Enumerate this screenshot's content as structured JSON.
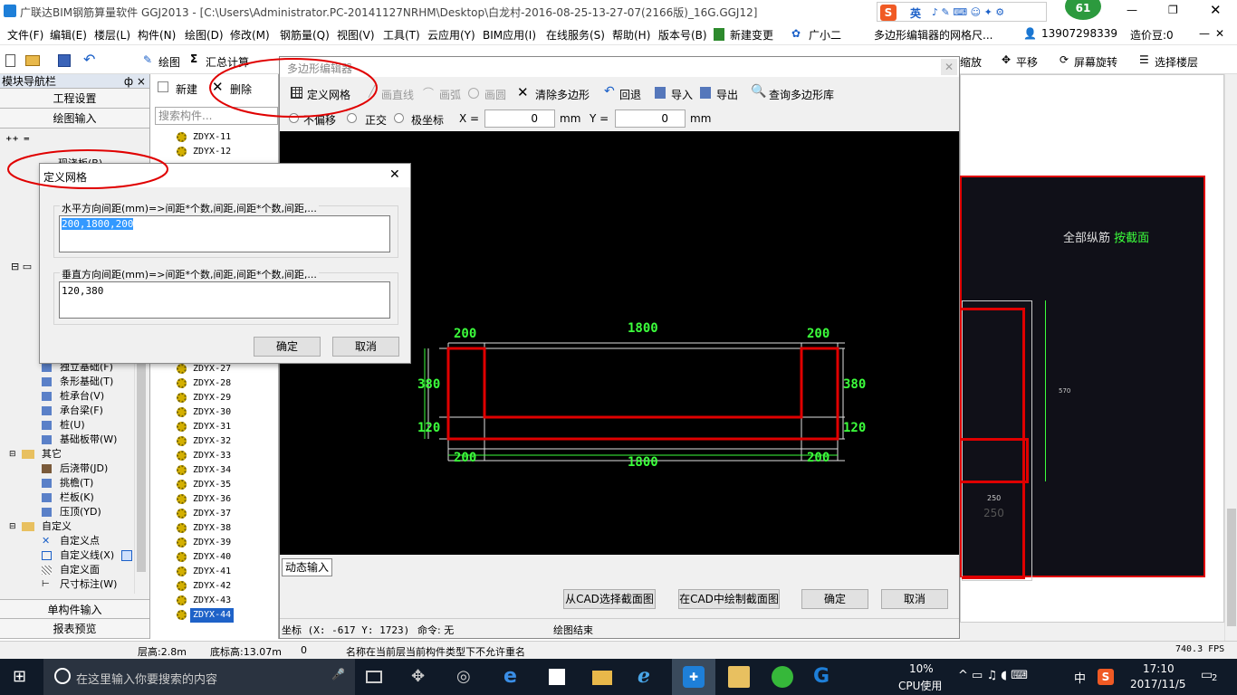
{
  "app": {
    "title": "广联达BIM钢筋算量软件 GGJ2013 - [C:\\Users\\Administrator.PC-20141127NRHM\\Desktop\\白龙村-2016-08-25-13-27-07(2166版)_16G.GGJ12]",
    "badge": "61",
    "ime": "英"
  },
  "menu": [
    "文件(F)",
    "编辑(E)",
    "楼层(L)",
    "构件(N)",
    "绘图(D)",
    "修改(M)",
    "钢筋量(Q)",
    "视图(V)",
    "工具(T)",
    "云应用(Y)",
    "BIM应用(I)",
    "在线服务(S)",
    "帮助(H)",
    "版本号(B)",
    "新建变更",
    "广小二"
  ],
  "menu_right": {
    "hint": "多边形编辑器的网格尺...",
    "phone": "13907298339",
    "price": "造价豆:0"
  },
  "toolbar": {
    "draw": "绘图",
    "calc": "汇总计算",
    "zoom": "缩放",
    "pan": "平移",
    "rotate": "屏幕旋转",
    "floor": "选择楼层"
  },
  "nav": {
    "title": "模块导航栏",
    "pin": "ф ×",
    "project": "工程设置",
    "drawing": "绘图输入",
    "single": "单构件输入",
    "report": "报表预览",
    "slab_cut": "现浇板(B)",
    "tree": [
      {
        "label": "独立基础(F)",
        "indent": 1
      },
      {
        "label": "条形基础(T)",
        "indent": 1
      },
      {
        "label": "桩承台(V)",
        "indent": 1
      },
      {
        "label": "承台梁(F)",
        "indent": 1
      },
      {
        "label": "桩(U)",
        "indent": 1
      },
      {
        "label": "基础板带(W)",
        "indent": 1
      },
      {
        "label": "其它",
        "indent": 0
      },
      {
        "label": "后浇带(JD)",
        "indent": 1
      },
      {
        "label": "挑檐(T)",
        "indent": 1
      },
      {
        "label": "栏板(K)",
        "indent": 1
      },
      {
        "label": "压顶(YD)",
        "indent": 1
      },
      {
        "label": "自定义",
        "indent": 0
      },
      {
        "label": "自定义点",
        "indent": 1
      },
      {
        "label": "自定义线(X)",
        "indent": 1
      },
      {
        "label": "自定义面",
        "indent": 1
      },
      {
        "label": "尺寸标注(W)",
        "indent": 1
      }
    ]
  },
  "components": {
    "new": "新建",
    "delete": "删除",
    "search_placeholder": "搜索构件...",
    "top_items": [
      "ZDYX-11",
      "ZDYX-12"
    ],
    "items": [
      "ZDYX-27",
      "ZDYX-28",
      "ZDYX-29",
      "ZDYX-30",
      "ZDYX-31",
      "ZDYX-32",
      "ZDYX-33",
      "ZDYX-34",
      "ZDYX-35",
      "ZDYX-36",
      "ZDYX-37",
      "ZDYX-38",
      "ZDYX-39",
      "ZDYX-40",
      "ZDYX-41",
      "ZDYX-42",
      "ZDYX-43",
      "ZDYX-44"
    ],
    "selected": "ZDYX-44"
  },
  "poly_editor": {
    "title": "多边形编辑器",
    "tools": {
      "grid": "定义网格",
      "line": "画直线",
      "arc": "画弧",
      "circle": "画圆",
      "clear": "清除多边形",
      "undo": "回退",
      "import": "导入",
      "export": "导出",
      "query": "查询多边形库"
    },
    "offset": {
      "none": "不偏移",
      "ortho": "正交",
      "polar": "极坐标",
      "x_label": "X =",
      "x_value": "0",
      "y_label": "Y =",
      "y_value": "0",
      "unit": "mm"
    },
    "dims_top": [
      "200",
      "1800",
      "200"
    ],
    "dims_bottom": [
      "200",
      "1800",
      "200"
    ],
    "dims_left": [
      "380",
      "120"
    ],
    "dims_right": [
      "380",
      "120"
    ],
    "dynamic_input": "动态输入",
    "btn_cad_select": "从CAD选择截面图",
    "btn_cad_draw": "在CAD中绘制截面图",
    "btn_ok": "确定",
    "btn_cancel": "取消",
    "status": {
      "coord": "坐标 (X: -617 Y: 1723)",
      "cmd": "命令: 无",
      "state": "绘图结束"
    }
  },
  "grid_dialog": {
    "title": "定义网格",
    "h_label": "水平方向间距(mm)=>间距*个数,间距,间距*个数,间距,...",
    "h_value": "200,1800,200",
    "v_label": "垂直方向间距(mm)=>间距*个数,间距,间距*个数,间距,...",
    "v_value": "120,380",
    "ok": "确定",
    "cancel": "取消"
  },
  "right_view": {
    "label": "全部纵筋",
    "label2": "按截面",
    "dim1": "570",
    "dim2": "250",
    "dim3": "250"
  },
  "status": {
    "floor_h": "层高:2.8m",
    "base_h": "底标高:13.07m",
    "zero": "0",
    "msg": "名称在当前层当前构件类型下不允许重名",
    "fps": "740.3 FPS"
  },
  "taskbar": {
    "search": "在这里输入你要搜索的内容",
    "cpu": "10%",
    "cpu_label": "CPU使用",
    "time": "17:10",
    "date": "2017/11/5",
    "lang": "中",
    "notif": "2"
  },
  "colors": {
    "red": "#e00000",
    "green": "#3cff3c",
    "canvas": "#000000",
    "highlight": "#ff0000"
  }
}
